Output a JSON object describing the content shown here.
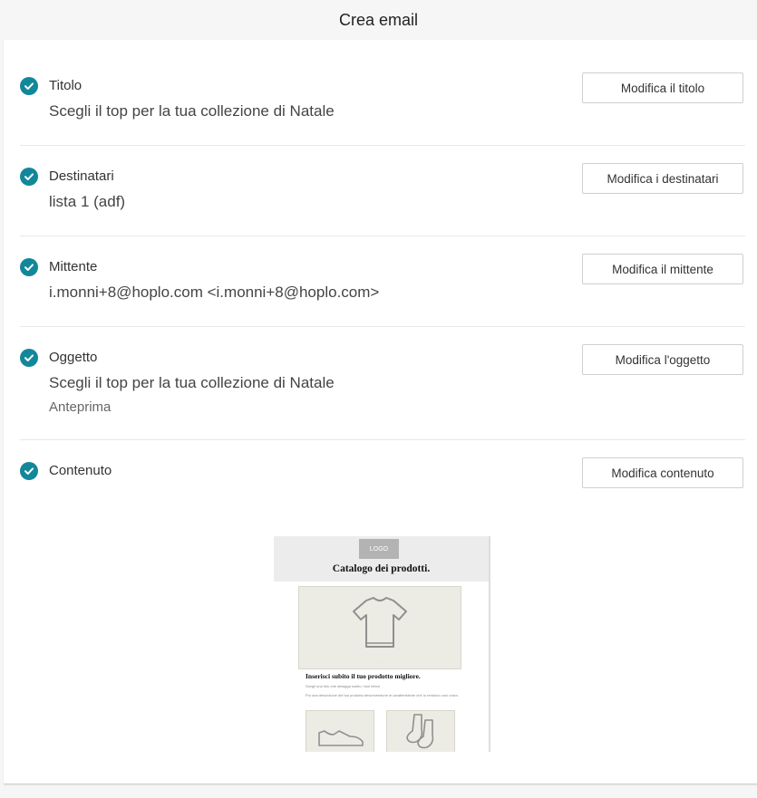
{
  "header": {
    "title": "Crea email"
  },
  "sections": [
    {
      "label": "Titolo",
      "value": "Scegli il top per la tua collezione di Natale",
      "button": "Modifica il titolo"
    },
    {
      "label": "Destinatari",
      "value": "lista 1 (adf)",
      "button": "Modifica i destinatari"
    },
    {
      "label": "Mittente",
      "value": "i.monni+8@hoplo.com <i.monni+8@hoplo.com>",
      "button": "Modifica il mittente"
    },
    {
      "label": "Oggetto",
      "value": "Scegli il top per la tua collezione di Natale",
      "subvalue": "Anteprima",
      "button": "Modifica l'oggetto"
    },
    {
      "label": "Contenuto",
      "button": "Modifica contenuto"
    }
  ],
  "preview": {
    "logo": "LOGO",
    "title": "Catalogo dei prodotti.",
    "headline": "Inserisci subito il tuo prodotto migliore.",
    "line1": "Scegli una foto che attragga subito i tuoi lettori",
    "line2": "Poi una descrizione del tuo prodotto descrivendone le caratteristiche che lo rendono così unico."
  },
  "colors": {
    "accent": "#13879a",
    "background": "#f6f6f6",
    "card": "#ffffff"
  },
  "icons": {
    "status": "check-circle-icon"
  }
}
